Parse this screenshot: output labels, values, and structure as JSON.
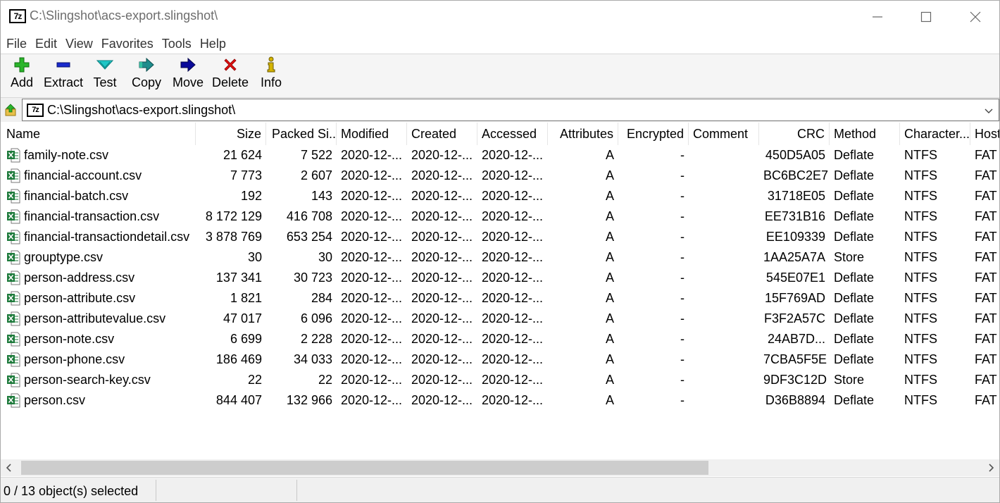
{
  "window": {
    "title": "C:\\Slingshot\\acs-export.slingshot\\",
    "logo_text": "7z"
  },
  "menu": [
    "File",
    "Edit",
    "View",
    "Favorites",
    "Tools",
    "Help"
  ],
  "toolbar": {
    "add": "Add",
    "extract": "Extract",
    "test": "Test",
    "copy": "Copy",
    "move": "Move",
    "delete": "Delete",
    "info": "Info"
  },
  "address": {
    "path": "C:\\Slingshot\\acs-export.slingshot\\"
  },
  "columns": {
    "name": "Name",
    "size": "Size",
    "packed": "Packed Si...",
    "modified": "Modified",
    "created": "Created",
    "accessed": "Accessed",
    "attributes": "Attributes",
    "encrypted": "Encrypted",
    "comment": "Comment",
    "crc": "CRC",
    "method": "Method",
    "characteristics": "Character...",
    "host": "Host"
  },
  "files": [
    {
      "name": "family-note.csv",
      "size": "21 624",
      "packed": "7 522",
      "modified": "2020-12-...",
      "created": "2020-12-...",
      "accessed": "2020-12-...",
      "attributes": "A",
      "encrypted": "-",
      "comment": "",
      "crc": "450D5A05",
      "method": "Deflate",
      "characteristics": "NTFS",
      "host": "FAT"
    },
    {
      "name": "financial-account.csv",
      "size": "7 773",
      "packed": "2 607",
      "modified": "2020-12-...",
      "created": "2020-12-...",
      "accessed": "2020-12-...",
      "attributes": "A",
      "encrypted": "-",
      "comment": "",
      "crc": "BC6BC2E7",
      "method": "Deflate",
      "characteristics": "NTFS",
      "host": "FAT"
    },
    {
      "name": "financial-batch.csv",
      "size": "192",
      "packed": "143",
      "modified": "2020-12-...",
      "created": "2020-12-...",
      "accessed": "2020-12-...",
      "attributes": "A",
      "encrypted": "-",
      "comment": "",
      "crc": "31718E05",
      "method": "Deflate",
      "characteristics": "NTFS",
      "host": "FAT"
    },
    {
      "name": "financial-transaction.csv",
      "size": "8 172 129",
      "packed": "416 708",
      "modified": "2020-12-...",
      "created": "2020-12-...",
      "accessed": "2020-12-...",
      "attributes": "A",
      "encrypted": "-",
      "comment": "",
      "crc": "EE731B16",
      "method": "Deflate",
      "characteristics": "NTFS",
      "host": "FAT"
    },
    {
      "name": "financial-transactiondetail.csv",
      "size": "3 878 769",
      "packed": "653 254",
      "modified": "2020-12-...",
      "created": "2020-12-...",
      "accessed": "2020-12-...",
      "attributes": "A",
      "encrypted": "-",
      "comment": "",
      "crc": "EE109339",
      "method": "Deflate",
      "characteristics": "NTFS",
      "host": "FAT"
    },
    {
      "name": "grouptype.csv",
      "size": "30",
      "packed": "30",
      "modified": "2020-12-...",
      "created": "2020-12-...",
      "accessed": "2020-12-...",
      "attributes": "A",
      "encrypted": "-",
      "comment": "",
      "crc": "1AA25A7A",
      "method": "Store",
      "characteristics": "NTFS",
      "host": "FAT"
    },
    {
      "name": "person-address.csv",
      "size": "137 341",
      "packed": "30 723",
      "modified": "2020-12-...",
      "created": "2020-12-...",
      "accessed": "2020-12-...",
      "attributes": "A",
      "encrypted": "-",
      "comment": "",
      "crc": "545E07E1",
      "method": "Deflate",
      "characteristics": "NTFS",
      "host": "FAT"
    },
    {
      "name": "person-attribute.csv",
      "size": "1 821",
      "packed": "284",
      "modified": "2020-12-...",
      "created": "2020-12-...",
      "accessed": "2020-12-...",
      "attributes": "A",
      "encrypted": "-",
      "comment": "",
      "crc": "15F769AD",
      "method": "Deflate",
      "characteristics": "NTFS",
      "host": "FAT"
    },
    {
      "name": "person-attributevalue.csv",
      "size": "47 017",
      "packed": "6 096",
      "modified": "2020-12-...",
      "created": "2020-12-...",
      "accessed": "2020-12-...",
      "attributes": "A",
      "encrypted": "-",
      "comment": "",
      "crc": "F3F2A57C",
      "method": "Deflate",
      "characteristics": "NTFS",
      "host": "FAT"
    },
    {
      "name": "person-note.csv",
      "size": "6 699",
      "packed": "2 228",
      "modified": "2020-12-...",
      "created": "2020-12-...",
      "accessed": "2020-12-...",
      "attributes": "A",
      "encrypted": "-",
      "comment": "",
      "crc": "24AB7D...",
      "method": "Deflate",
      "characteristics": "NTFS",
      "host": "FAT"
    },
    {
      "name": "person-phone.csv",
      "size": "186 469",
      "packed": "34 033",
      "modified": "2020-12-...",
      "created": "2020-12-...",
      "accessed": "2020-12-...",
      "attributes": "A",
      "encrypted": "-",
      "comment": "",
      "crc": "7CBA5F5E",
      "method": "Deflate",
      "characteristics": "NTFS",
      "host": "FAT"
    },
    {
      "name": "person-search-key.csv",
      "size": "22",
      "packed": "22",
      "modified": "2020-12-...",
      "created": "2020-12-...",
      "accessed": "2020-12-...",
      "attributes": "A",
      "encrypted": "-",
      "comment": "",
      "crc": "9DF3C12D",
      "method": "Store",
      "characteristics": "NTFS",
      "host": "FAT"
    },
    {
      "name": "person.csv",
      "size": "844 407",
      "packed": "132 966",
      "modified": "2020-12-...",
      "created": "2020-12-...",
      "accessed": "2020-12-...",
      "attributes": "A",
      "encrypted": "-",
      "comment": "",
      "crc": "D36B8894",
      "method": "Deflate",
      "characteristics": "NTFS",
      "host": "FAT"
    }
  ],
  "status": {
    "selection": "0 / 13 object(s) selected"
  },
  "colors": {
    "add_icon": "#2bb52b",
    "extract_icon": "#1a2acd",
    "test_icon": "#1ec6c6",
    "copy_icon": "#1f8c8c",
    "move_icon": "#0a0a9a",
    "delete_icon": "#e01010",
    "info_icon": "#d4b400",
    "excel_icon": "#1e7b3c"
  },
  "icons": {
    "add": "plus-icon",
    "extract": "minus-icon",
    "test": "check-icon",
    "copy": "arrow-right-icon",
    "move": "arrow-right-icon",
    "delete": "x-icon",
    "info": "info-icon",
    "file": "excel-csv-icon",
    "up": "folder-up-icon"
  }
}
